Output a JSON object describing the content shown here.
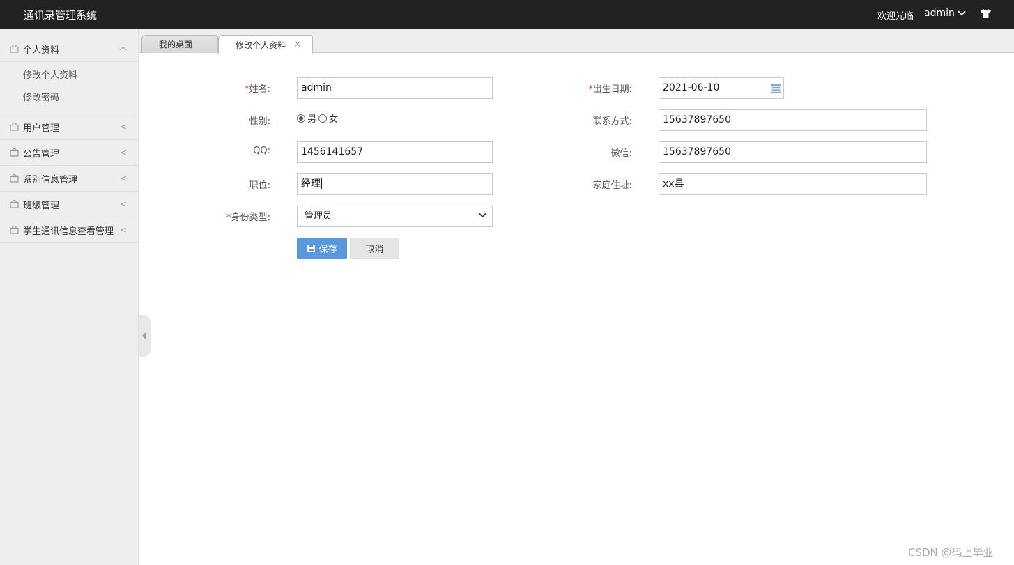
{
  "header": {
    "app_title": "通讯录管理系统",
    "welcome": "欢迎光临",
    "username": "admin"
  },
  "sidebar": {
    "items": [
      {
        "label": "个人资料",
        "arrow": "^"
      },
      {
        "label": "用户管理",
        "arrow": "<"
      },
      {
        "label": "公告管理",
        "arrow": "<"
      },
      {
        "label": "系别信息管理",
        "arrow": "<"
      },
      {
        "label": "班级管理",
        "arrow": "<"
      },
      {
        "label": "学生通讯信息查看管理",
        "arrow": "<"
      }
    ],
    "submenu": [
      "修改个人资料",
      "修改密码"
    ]
  },
  "tabs": [
    {
      "label": "我的桌面"
    },
    {
      "label": "修改个人资料",
      "close": "×"
    }
  ],
  "form": {
    "required_mark": "*",
    "name_label": "姓名:",
    "name_value": "admin",
    "birth_label": "出生日期:",
    "birth_value": "2021-06-10",
    "gender_label": "性别:",
    "gender_options": [
      "男",
      "女"
    ],
    "gender_selected": "男",
    "contact_label": "联系方式:",
    "contact_value": "15637897650",
    "qq_label": "QQ:",
    "qq_value": "1456141657",
    "wechat_label": "微信:",
    "wechat_value": "15637897650",
    "position_label": "职位:",
    "position_value": "经理",
    "address_label": "家庭住址:",
    "address_value": "xx县",
    "identity_label": "身份类型:",
    "identity_value": "管理员",
    "save_label": "保存",
    "cancel_label": "取消"
  },
  "watermark": "CSDN @码上毕业",
  "colors": {
    "topbar": "#222222",
    "sidebar": "#eeeeee",
    "save_button": "#5a98de",
    "required": "#ee3333"
  }
}
